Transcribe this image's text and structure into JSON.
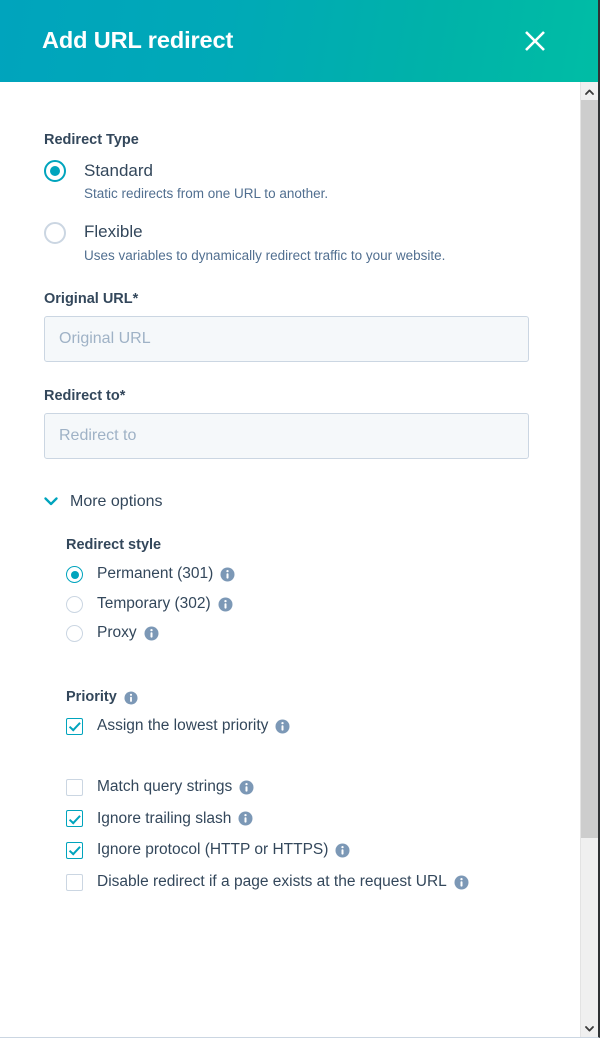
{
  "header": {
    "title": "Add URL redirect",
    "close_label": "✕",
    "gradient_from": "#00a4bd",
    "gradient_to": "#00bda5"
  },
  "colors": {
    "accent": "#00a4bd",
    "text": "#33475b",
    "muted_text": "#516f90",
    "border": "#cbd6e2",
    "input_bg": "#f5f8fa",
    "info_icon": "#7c98b6"
  },
  "redirect_type": {
    "label": "Redirect Type",
    "options": [
      {
        "label": "Standard",
        "helper": "Static redirects from one URL to another.",
        "selected": true
      },
      {
        "label": "Flexible",
        "helper": "Uses variables to dynamically redirect traffic to your website.",
        "selected": false
      }
    ]
  },
  "fields": {
    "original_url": {
      "label": "Original URL",
      "required_mark": "*",
      "placeholder": "Original URL",
      "value": ""
    },
    "redirect_to": {
      "label": "Redirect to",
      "required_mark": "*",
      "placeholder": "Redirect to",
      "value": ""
    }
  },
  "more_options": {
    "label": "More options",
    "expanded": true,
    "redirect_style": {
      "label": "Redirect style",
      "options": [
        {
          "label": "Permanent (301)",
          "selected": true,
          "has_info": true
        },
        {
          "label": "Temporary (302)",
          "selected": false,
          "has_info": true
        },
        {
          "label": "Proxy",
          "selected": false,
          "has_info": true
        }
      ]
    },
    "priority": {
      "label": "Priority",
      "has_info": true,
      "checkboxes": [
        {
          "label": "Assign the lowest priority",
          "checked": true,
          "has_info": true
        }
      ]
    },
    "matching_options": [
      {
        "label": "Match query strings",
        "checked": false,
        "has_info": true
      },
      {
        "label": "Ignore trailing slash",
        "checked": true,
        "has_info": true
      },
      {
        "label": "Ignore protocol (HTTP or HTTPS)",
        "checked": true,
        "has_info": true
      },
      {
        "label": "Disable redirect if a page exists at the request URL",
        "checked": false,
        "has_info": true
      }
    ]
  },
  "scrollbar": {
    "up_arrow": "⌃",
    "down_arrow": "⌄",
    "thumb_position": "top"
  }
}
